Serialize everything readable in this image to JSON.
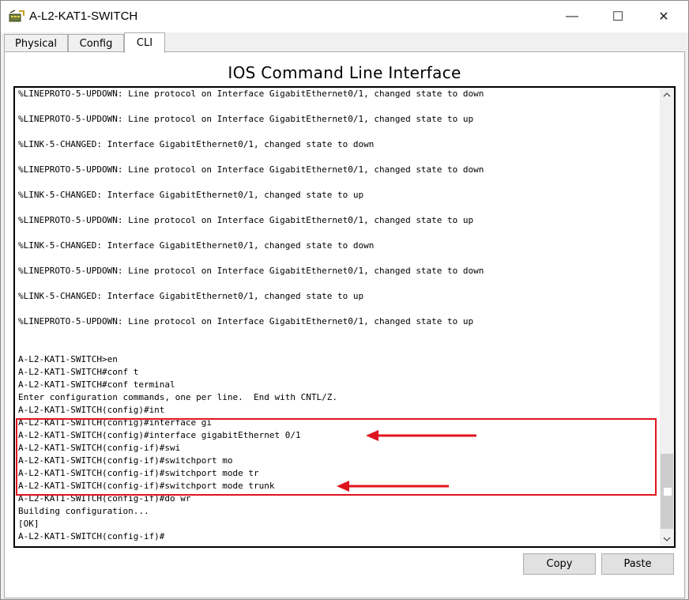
{
  "window": {
    "title": "A-L2-KAT1-SWITCH",
    "minimize_glyph": "—",
    "maximize_glyph": "☐",
    "close_glyph": "✕"
  },
  "tabs": [
    {
      "label": "Physical",
      "active": false
    },
    {
      "label": "Config",
      "active": false
    },
    {
      "label": "CLI",
      "active": true
    }
  ],
  "panel": {
    "title": "IOS Command Line Interface"
  },
  "console": {
    "lines": [
      "%LINEPROTO-5-UPDOWN: Line protocol on Interface GigabitEthernet0/1, changed state to down",
      "",
      "%LINEPROTO-5-UPDOWN: Line protocol on Interface GigabitEthernet0/1, changed state to up",
      "",
      "%LINK-5-CHANGED: Interface GigabitEthernet0/1, changed state to down",
      "",
      "%LINEPROTO-5-UPDOWN: Line protocol on Interface GigabitEthernet0/1, changed state to down",
      "",
      "%LINK-5-CHANGED: Interface GigabitEthernet0/1, changed state to up",
      "",
      "%LINEPROTO-5-UPDOWN: Line protocol on Interface GigabitEthernet0/1, changed state to up",
      "",
      "%LINK-5-CHANGED: Interface GigabitEthernet0/1, changed state to down",
      "",
      "%LINEPROTO-5-UPDOWN: Line protocol on Interface GigabitEthernet0/1, changed state to down",
      "",
      "%LINK-5-CHANGED: Interface GigabitEthernet0/1, changed state to up",
      "",
      "%LINEPROTO-5-UPDOWN: Line protocol on Interface GigabitEthernet0/1, changed state to up",
      "",
      "",
      "A-L2-KAT1-SWITCH>en",
      "A-L2-KAT1-SWITCH#conf t",
      "A-L2-KAT1-SWITCH#conf terminal",
      "Enter configuration commands, one per line.  End with CNTL/Z.",
      "A-L2-KAT1-SWITCH(config)#int",
      "A-L2-KAT1-SWITCH(config)#interface gi",
      "A-L2-KAT1-SWITCH(config)#interface gigabitEthernet 0/1",
      "A-L2-KAT1-SWITCH(config-if)#swi",
      "A-L2-KAT1-SWITCH(config-if)#switchport mo",
      "A-L2-KAT1-SWITCH(config-if)#switchport mode tr",
      "A-L2-KAT1-SWITCH(config-if)#switchport mode trunk",
      "A-L2-KAT1-SWITCH(config-if)#do wr",
      "Building configuration...",
      "[OK]",
      "A-L2-KAT1-SWITCH(config-if)#"
    ]
  },
  "buttons": {
    "copy_label": "Copy",
    "paste_label": "Paste"
  },
  "colors": {
    "annotation_red": "#e0141e"
  }
}
